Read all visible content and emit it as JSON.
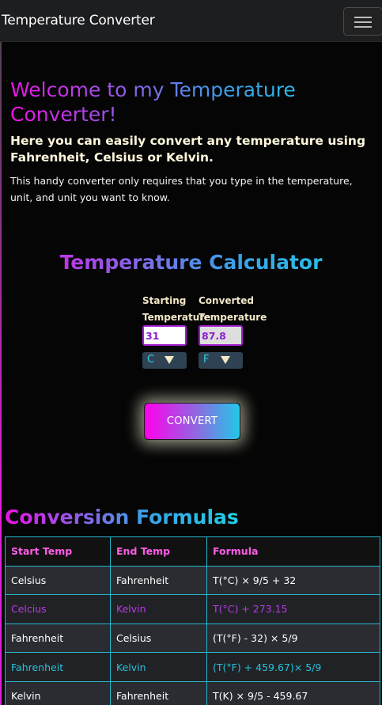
{
  "navbar": {
    "brand": "Temperature Converter"
  },
  "hero": {
    "title": "Welcome to my Temperature Converter!",
    "subtitle": "Here you can easily convert any temperature using Fahrenheit, Celsius or Kelvin.",
    "description": "This handy converter only requires that you type in the temperature, unit, and unit you want to know."
  },
  "calculator": {
    "title": "Temperature Calculator",
    "starting_label": "Starting Temperature",
    "converted_label": "Converted Temperature",
    "starting_value": "31",
    "converted_value": "87.8",
    "starting_unit": "C",
    "converted_unit": "F",
    "convert_label": "CONVERT"
  },
  "formulas": {
    "title": "Conversion Formulas",
    "headers": [
      "Start Temp",
      "End Temp",
      "Formula"
    ],
    "rows": [
      [
        "Celsius",
        "Fahrenheit",
        "T(°C) × 9/5 + 32"
      ],
      [
        "Celcius",
        "Kelvin",
        "T(°C) + 273.15"
      ],
      [
        "Fahrenheit",
        "Celsius",
        "(T(°F) - 32) × 5/9"
      ],
      [
        "Fahrenheit",
        "Kelvin",
        "(T(°F) + 459.67)× 5/9"
      ],
      [
        "Kelvin",
        "Fahrenheit",
        "T(K) × 9/5 - 459.67"
      ]
    ]
  },
  "colors": {
    "accent_pink": "#ee11e5",
    "accent_cyan": "#1fd0e6",
    "accent_purple": "#a31fd0",
    "table_border": "#26b8d0"
  },
  "icons": {
    "menu": "hamburger-menu-icon",
    "dropdown": "chevron-down-icon"
  }
}
